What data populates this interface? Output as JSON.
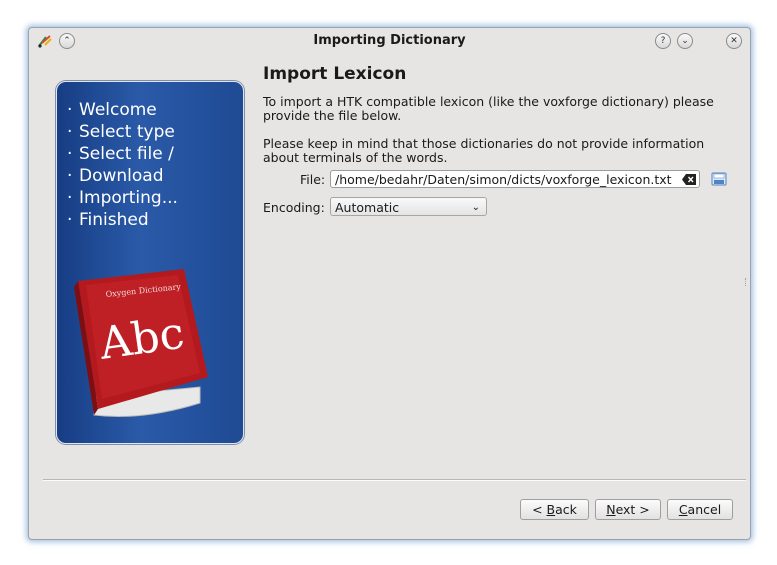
{
  "window": {
    "title": "Importing Dictionary"
  },
  "titlebar_buttons": {
    "help": "?",
    "minimize": "⌄",
    "close": "✕",
    "shade": "⌃"
  },
  "sidebar": {
    "steps": [
      "Welcome",
      "Select type",
      "Select file /",
      "Download",
      "Importing...",
      "Finished"
    ],
    "book": {
      "cover_title": "Oxygen Dictionary",
      "cover_text": "Abc"
    }
  },
  "page": {
    "heading": "Import Lexicon",
    "intro_line1": "To import a HTK compatible lexicon (like the voxforge dictionary) please",
    "intro_line2": "provide the file below.",
    "note_line1": "Please keep in mind that those dictionaries do not provide information",
    "note_line2": "about terminals of the words."
  },
  "form": {
    "file_label": "File:",
    "file_value": "/home/bedahr/Daten/simon/dicts/voxforge_lexicon.txt",
    "encoding_label": "Encoding:",
    "encoding_value": "Automatic"
  },
  "buttons": {
    "back_prefix": "< ",
    "back_accel": "B",
    "back_rest": "ack",
    "next_accel": "N",
    "next_rest": "ext >",
    "cancel_accel": "C",
    "cancel_rest": "ancel"
  },
  "colors": {
    "panel": "#2a5aa8",
    "window_bg": "#e7e5e3",
    "book_red": "#b3191d"
  }
}
